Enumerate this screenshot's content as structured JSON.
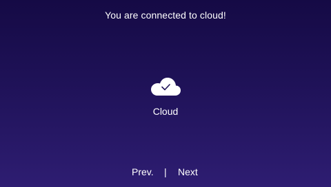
{
  "header": {
    "message": "You are connected to cloud!"
  },
  "status": {
    "icon": "cloud-check-icon",
    "label": "Cloud"
  },
  "navigation": {
    "prev_label": "Prev.",
    "separator": "|",
    "next_label": "Next"
  },
  "colors": {
    "background_top": "#150a45",
    "background_bottom": "#2e1d72",
    "text": "#ffffff",
    "icon_fill": "#ffffff",
    "check_stroke": "#1f1258"
  }
}
